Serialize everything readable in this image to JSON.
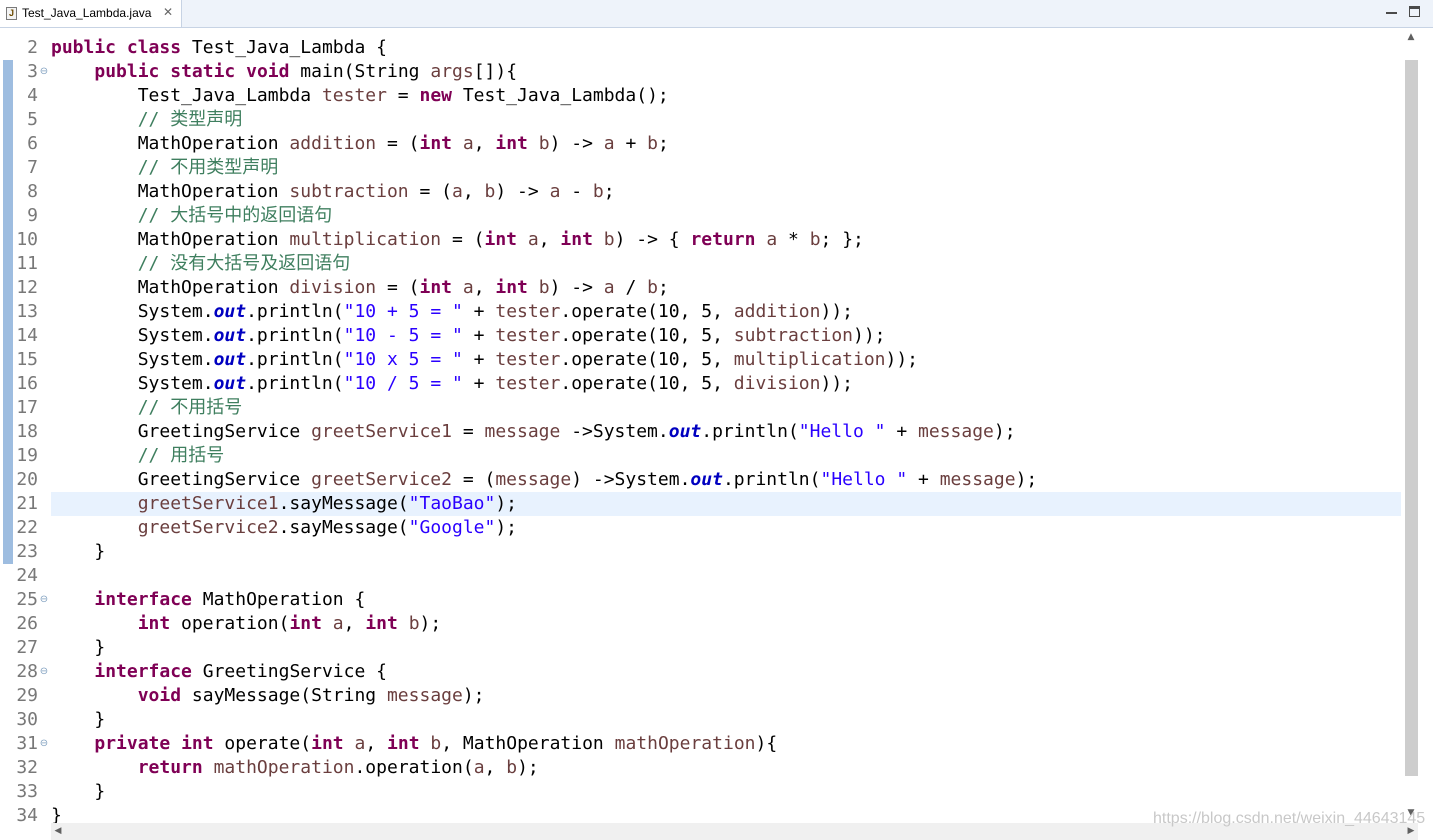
{
  "tab": {
    "title": "Test_Java_Lambda.java",
    "close": "✕",
    "file_icon": "java-file-icon"
  },
  "window_controls": [
    "minimize-icon",
    "maximize-icon"
  ],
  "editor": {
    "current_line": 21,
    "line_numbers": [
      "2",
      "3",
      "4",
      "5",
      "6",
      "7",
      "8",
      "9",
      "10",
      "11",
      "12",
      "13",
      "14",
      "15",
      "16",
      "17",
      "18",
      "19",
      "20",
      "21",
      "22",
      "23",
      "24",
      "25",
      "26",
      "27",
      "28",
      "29",
      "30",
      "31",
      "32",
      "33",
      "34"
    ],
    "fold_lines": [
      "3",
      "25",
      "28",
      "31"
    ],
    "fold_glyph": "⊖",
    "lines": [
      [
        [
          "kw",
          "public"
        ],
        [
          "t",
          " "
        ],
        [
          "kw",
          "class"
        ],
        [
          "t",
          " Test_Java_Lambda {"
        ]
      ],
      [
        [
          "t",
          "    "
        ],
        [
          "kw",
          "public"
        ],
        [
          "t",
          " "
        ],
        [
          "kw",
          "static"
        ],
        [
          "t",
          " "
        ],
        [
          "kw",
          "void"
        ],
        [
          "t",
          " main(String "
        ],
        [
          "va",
          "args"
        ],
        [
          "t",
          "[]){"
        ]
      ],
      [
        [
          "t",
          "        Test_Java_Lambda "
        ],
        [
          "va",
          "tester"
        ],
        [
          "t",
          " = "
        ],
        [
          "kw",
          "new"
        ],
        [
          "t",
          " Test_Java_Lambda();"
        ]
      ],
      [
        [
          "t",
          "        "
        ],
        [
          "cm",
          "// 类型声明"
        ]
      ],
      [
        [
          "t",
          "        MathOperation "
        ],
        [
          "va",
          "addition"
        ],
        [
          "t",
          " = ("
        ],
        [
          "kw",
          "int"
        ],
        [
          "t",
          " "
        ],
        [
          "va",
          "a"
        ],
        [
          "t",
          ", "
        ],
        [
          "kw",
          "int"
        ],
        [
          "t",
          " "
        ],
        [
          "va",
          "b"
        ],
        [
          "t",
          ") -> "
        ],
        [
          "va",
          "a"
        ],
        [
          "t",
          " + "
        ],
        [
          "va",
          "b"
        ],
        [
          "t",
          ";"
        ]
      ],
      [
        [
          "t",
          "        "
        ],
        [
          "cm",
          "// 不用类型声明"
        ]
      ],
      [
        [
          "t",
          "        MathOperation "
        ],
        [
          "va",
          "subtraction"
        ],
        [
          "t",
          " = ("
        ],
        [
          "va",
          "a"
        ],
        [
          "t",
          ", "
        ],
        [
          "va",
          "b"
        ],
        [
          "t",
          ") -> "
        ],
        [
          "va",
          "a"
        ],
        [
          "t",
          " - "
        ],
        [
          "va",
          "b"
        ],
        [
          "t",
          ";"
        ]
      ],
      [
        [
          "t",
          "        "
        ],
        [
          "cm",
          "// 大括号中的返回语句"
        ]
      ],
      [
        [
          "t",
          "        MathOperation "
        ],
        [
          "va",
          "multiplication"
        ],
        [
          "t",
          " = ("
        ],
        [
          "kw",
          "int"
        ],
        [
          "t",
          " "
        ],
        [
          "va",
          "a"
        ],
        [
          "t",
          ", "
        ],
        [
          "kw",
          "int"
        ],
        [
          "t",
          " "
        ],
        [
          "va",
          "b"
        ],
        [
          "t",
          ") -> { "
        ],
        [
          "kw",
          "return"
        ],
        [
          "t",
          " "
        ],
        [
          "va",
          "a"
        ],
        [
          "t",
          " * "
        ],
        [
          "va",
          "b"
        ],
        [
          "t",
          "; };"
        ]
      ],
      [
        [
          "t",
          "        "
        ],
        [
          "cm",
          "// 没有大括号及返回语句"
        ]
      ],
      [
        [
          "t",
          "        MathOperation "
        ],
        [
          "va",
          "division"
        ],
        [
          "t",
          " = ("
        ],
        [
          "kw",
          "int"
        ],
        [
          "t",
          " "
        ],
        [
          "va",
          "a"
        ],
        [
          "t",
          ", "
        ],
        [
          "kw",
          "int"
        ],
        [
          "t",
          " "
        ],
        [
          "va",
          "b"
        ],
        [
          "t",
          ") -> "
        ],
        [
          "va",
          "a"
        ],
        [
          "t",
          " / "
        ],
        [
          "va",
          "b"
        ],
        [
          "t",
          ";"
        ]
      ],
      [
        [
          "t",
          "        System."
        ],
        [
          "fi",
          "out"
        ],
        [
          "t",
          ".println("
        ],
        [
          "st",
          "\"10 + 5 = \""
        ],
        [
          "t",
          " + "
        ],
        [
          "va",
          "tester"
        ],
        [
          "t",
          ".operate(10, 5, "
        ],
        [
          "va",
          "addition"
        ],
        [
          "t",
          "));"
        ]
      ],
      [
        [
          "t",
          "        System."
        ],
        [
          "fi",
          "out"
        ],
        [
          "t",
          ".println("
        ],
        [
          "st",
          "\"10 - 5 = \""
        ],
        [
          "t",
          " + "
        ],
        [
          "va",
          "tester"
        ],
        [
          "t",
          ".operate(10, 5, "
        ],
        [
          "va",
          "subtraction"
        ],
        [
          "t",
          "));"
        ]
      ],
      [
        [
          "t",
          "        System."
        ],
        [
          "fi",
          "out"
        ],
        [
          "t",
          ".println("
        ],
        [
          "st",
          "\"10 x 5 = \""
        ],
        [
          "t",
          " + "
        ],
        [
          "va",
          "tester"
        ],
        [
          "t",
          ".operate(10, 5, "
        ],
        [
          "va",
          "multiplication"
        ],
        [
          "t",
          "));"
        ]
      ],
      [
        [
          "t",
          "        System."
        ],
        [
          "fi",
          "out"
        ],
        [
          "t",
          ".println("
        ],
        [
          "st",
          "\"10 / 5 = \""
        ],
        [
          "t",
          " + "
        ],
        [
          "va",
          "tester"
        ],
        [
          "t",
          ".operate(10, 5, "
        ],
        [
          "va",
          "division"
        ],
        [
          "t",
          "));"
        ]
      ],
      [
        [
          "t",
          "        "
        ],
        [
          "cm",
          "// 不用括号"
        ]
      ],
      [
        [
          "t",
          "        GreetingService "
        ],
        [
          "va",
          "greetService1"
        ],
        [
          "t",
          " = "
        ],
        [
          "va",
          "message"
        ],
        [
          "t",
          " ->System."
        ],
        [
          "fi",
          "out"
        ],
        [
          "t",
          ".println("
        ],
        [
          "st",
          "\"Hello \""
        ],
        [
          "t",
          " + "
        ],
        [
          "va",
          "message"
        ],
        [
          "t",
          ");"
        ]
      ],
      [
        [
          "t",
          "        "
        ],
        [
          "cm",
          "// 用括号"
        ]
      ],
      [
        [
          "t",
          "        GreetingService "
        ],
        [
          "va",
          "greetService2"
        ],
        [
          "t",
          " = ("
        ],
        [
          "va",
          "message"
        ],
        [
          "t",
          ") ->System."
        ],
        [
          "fi",
          "out"
        ],
        [
          "t",
          ".println("
        ],
        [
          "st",
          "\"Hello \""
        ],
        [
          "t",
          " + "
        ],
        [
          "va",
          "message"
        ],
        [
          "t",
          ");"
        ]
      ],
      [
        [
          "t",
          "        "
        ],
        [
          "va",
          "greetService1"
        ],
        [
          "t",
          ".sayMessage("
        ],
        [
          "st",
          "\"TaoBao\""
        ],
        [
          "t",
          ");"
        ]
      ],
      [
        [
          "t",
          "        "
        ],
        [
          "va",
          "greetService2"
        ],
        [
          "t",
          ".sayMessage("
        ],
        [
          "st",
          "\"Google\""
        ],
        [
          "t",
          ");"
        ]
      ],
      [
        [
          "t",
          "    }"
        ]
      ],
      [
        [
          "t",
          ""
        ]
      ],
      [
        [
          "t",
          "    "
        ],
        [
          "kw",
          "interface"
        ],
        [
          "t",
          " MathOperation {"
        ]
      ],
      [
        [
          "t",
          "        "
        ],
        [
          "kw",
          "int"
        ],
        [
          "t",
          " operation("
        ],
        [
          "kw",
          "int"
        ],
        [
          "t",
          " "
        ],
        [
          "va",
          "a"
        ],
        [
          "t",
          ", "
        ],
        [
          "kw",
          "int"
        ],
        [
          "t",
          " "
        ],
        [
          "va",
          "b"
        ],
        [
          "t",
          ");"
        ]
      ],
      [
        [
          "t",
          "    }"
        ]
      ],
      [
        [
          "t",
          "    "
        ],
        [
          "kw",
          "interface"
        ],
        [
          "t",
          " GreetingService {"
        ]
      ],
      [
        [
          "t",
          "        "
        ],
        [
          "kw",
          "void"
        ],
        [
          "t",
          " sayMessage(String "
        ],
        [
          "va",
          "message"
        ],
        [
          "t",
          ");"
        ]
      ],
      [
        [
          "t",
          "    }"
        ]
      ],
      [
        [
          "t",
          "    "
        ],
        [
          "kw",
          "private"
        ],
        [
          "t",
          " "
        ],
        [
          "kw",
          "int"
        ],
        [
          "t",
          " operate("
        ],
        [
          "kw",
          "int"
        ],
        [
          "t",
          " "
        ],
        [
          "va",
          "a"
        ],
        [
          "t",
          ", "
        ],
        [
          "kw",
          "int"
        ],
        [
          "t",
          " "
        ],
        [
          "va",
          "b"
        ],
        [
          "t",
          ", MathOperation "
        ],
        [
          "va",
          "mathOperation"
        ],
        [
          "t",
          "){"
        ]
      ],
      [
        [
          "t",
          "        "
        ],
        [
          "kw",
          "return"
        ],
        [
          "t",
          " "
        ],
        [
          "va",
          "mathOperation"
        ],
        [
          "t",
          ".operation("
        ],
        [
          "va",
          "a"
        ],
        [
          "t",
          ", "
        ],
        [
          "va",
          "b"
        ],
        [
          "t",
          ");"
        ]
      ],
      [
        [
          "t",
          "    }"
        ]
      ],
      [
        [
          "t",
          "}"
        ]
      ]
    ]
  },
  "scrollbars": {
    "up": "▲",
    "down": "▼",
    "left": "◀",
    "right": "▶"
  },
  "watermark": "https://blog.csdn.net/weixin_44643145"
}
